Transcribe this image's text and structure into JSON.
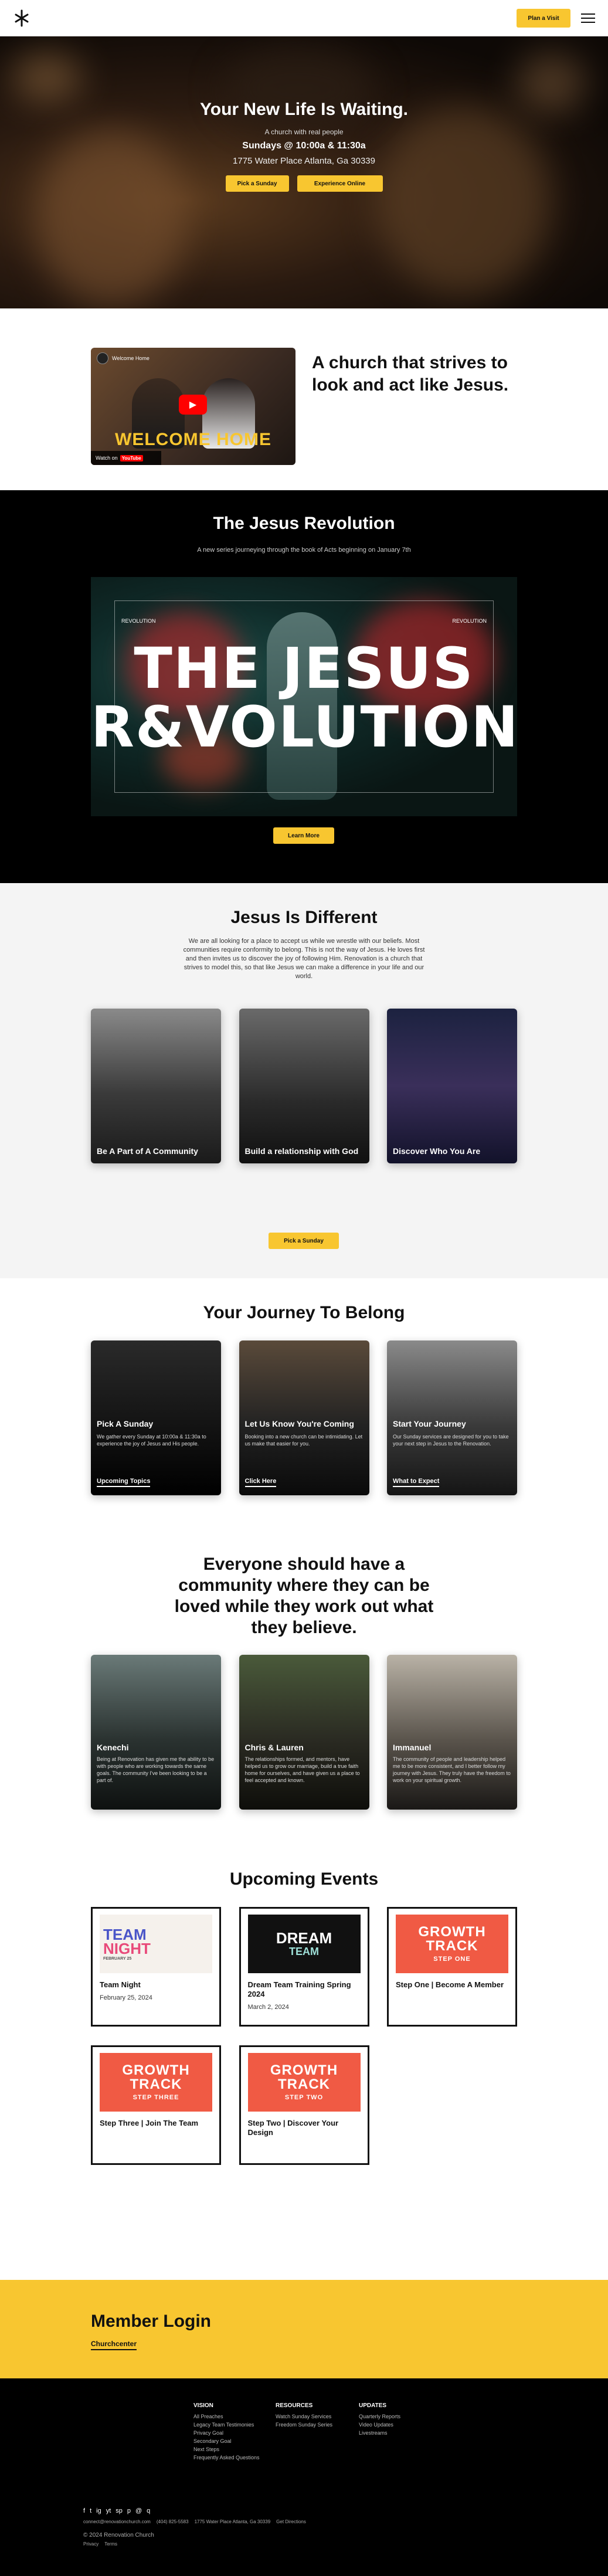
{
  "header": {
    "logo_icon": "cross-logo-icon",
    "plan_visit_label": "Plan a Visit",
    "menu_icon": "hamburger-menu-icon"
  },
  "hero": {
    "title": "Your New Life Is Waiting.",
    "subtitle": "A church with real people",
    "times": "Sundays @ 10:00a & 11:30a",
    "address": "1775 Water Place Atlanta, Ga 30339",
    "btn_sunday": "Pick a Sunday",
    "btn_online": "Experience Online"
  },
  "video": {
    "channel": "Welcome Home",
    "overlay_text": "WELCOME HOME",
    "watch_on": "Watch on",
    "youtube": "YouTube"
  },
  "intro": {
    "tagline": "A church that strives to look and act like Jesus."
  },
  "revolution": {
    "title": "The Jesus Revolution",
    "subtitle": "A new series journeying through the book of Acts beginning on January 7th",
    "art_line1": "THE JESUS",
    "art_line2": "R&VOLUTION",
    "art_label_left": "REVOLUTION",
    "art_label_right": "REVOLUTION",
    "learn_more": "Learn More"
  },
  "different": {
    "title": "Jesus Is Different",
    "paragraph": "We are all looking for a place to accept us while we wrestle with our beliefs. Most communities require conformity to belong. This is not the way of Jesus. He loves first and then invites us to discover the joy of following Him. Renovation is a church that strives to model this, so that like Jesus we can make a difference in your life and our world.",
    "cards": [
      {
        "label": "Be A Part of A Community"
      },
      {
        "label": "Build a relationship with God"
      },
      {
        "label": "Discover Who You Are"
      }
    ],
    "btn": "Pick a Sunday"
  },
  "journey": {
    "title": "Your Journey To Belong",
    "cards": [
      {
        "title": "Pick A Sunday",
        "text": "We gather every Sunday at 10:00a & 11:30a to experience the joy of Jesus and His people.",
        "link": "Upcoming Topics"
      },
      {
        "title": "Let Us Know You're Coming",
        "text": "Booking into a new church can be intimidating. Let us make that easier for you.",
        "link": "Click Here"
      },
      {
        "title": "Start Your Journey",
        "text": "Our Sunday services are designed for you to take your next step in Jesus to the Renovation.",
        "link": "What to Expect"
      }
    ]
  },
  "community": {
    "title": "Everyone should have a community where they can be loved while they work out what they believe.",
    "cards": [
      {
        "name": "Kenechi",
        "text": "Being at Renovation has given me the ability to be with people who are working towards the same goals. The community I've been looking to be a part of."
      },
      {
        "name": "Chris & Lauren",
        "text": "The relationships formed, and mentors, have helped us to grow our marriage, build a true faith home for ourselves, and have given us a place to feel accepted and known."
      },
      {
        "name": "Immanuel",
        "text": "The community of people and leadership helped me to be more consistent, and I better follow my journey with Jesus. They truly have the freedom to work on your spiritual growth."
      }
    ]
  },
  "events": {
    "title": "Upcoming Events",
    "items": [
      {
        "thumb_line1": "TEAM",
        "thumb_line2": "NIGHT",
        "thumb_sub": "FEBRUARY 25",
        "title": "Team Night",
        "date": "February 25, 2024"
      },
      {
        "thumb_line1": "DREAM",
        "thumb_line2": "TEAM",
        "thumb_sub": "",
        "title": "Dream Team Training Spring 2024",
        "date": "March 2, 2024"
      },
      {
        "thumb_line1": "GROWTH",
        "thumb_line2": "TRACK",
        "thumb_sub": "STEP ONE",
        "title": "Step One | Become A Member",
        "date": ""
      },
      {
        "thumb_line1": "GROWTH",
        "thumb_line2": "TRACK",
        "thumb_sub": "STEP THREE",
        "title": "Step Three | Join The Team",
        "date": ""
      },
      {
        "thumb_line1": "GROWTH",
        "thumb_line2": "TRACK",
        "thumb_sub": "STEP TWO",
        "title": "Step Two | Discover Your Design",
        "date": ""
      }
    ]
  },
  "member": {
    "title": "Member Login",
    "link": "Churchcenter"
  },
  "footer": {
    "vision": {
      "heading": "VISION",
      "items": [
        "All Preaches",
        "Legacy Team Testimonies",
        "Privacy Goal",
        "Secondary Goal",
        "Next Steps",
        "Frequently Asked Questions"
      ]
    },
    "resources": {
      "heading": "RESOURCES",
      "items": [
        "Watch Sunday Services",
        "Freedom Sunday Series"
      ]
    },
    "updates": {
      "heading": "UPDATES",
      "items": [
        "Quarterly Reports",
        "Video Updates",
        "Livestreams"
      ]
    },
    "socials": [
      "f",
      "t",
      "ig",
      "yt",
      "sp",
      "p",
      "@",
      "q"
    ],
    "email": "connect@renovationchurch.com",
    "phone": "(404) 825-5583",
    "address": "1775 Water Place Atlanta, Ga 30339",
    "directions": "Get Directions",
    "copyright": "© 2024 Renovation Church",
    "privacy": "Privacy",
    "terms": "Terms"
  }
}
